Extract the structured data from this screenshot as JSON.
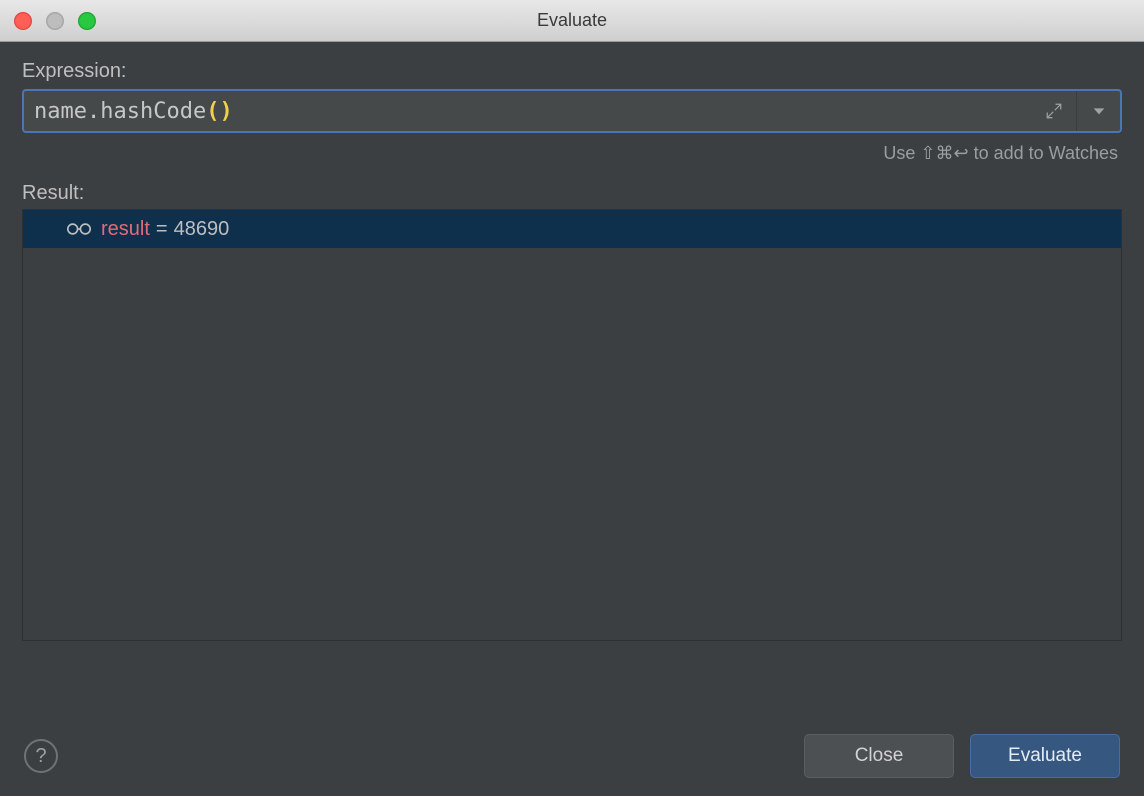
{
  "window": {
    "title": "Evaluate"
  },
  "expression": {
    "label": "Expression:",
    "tokens": {
      "obj": "name",
      "dot": ".",
      "method": "hashCode",
      "lparen": "(",
      "rparen": ")"
    }
  },
  "hint": {
    "text": "Use ⇧⌘↩ to add to Watches"
  },
  "result": {
    "label": "Result:",
    "row": {
      "name": "result",
      "eq": "=",
      "value": "48690"
    }
  },
  "buttons": {
    "help": "?",
    "close": "Close",
    "evaluate": "Evaluate"
  }
}
